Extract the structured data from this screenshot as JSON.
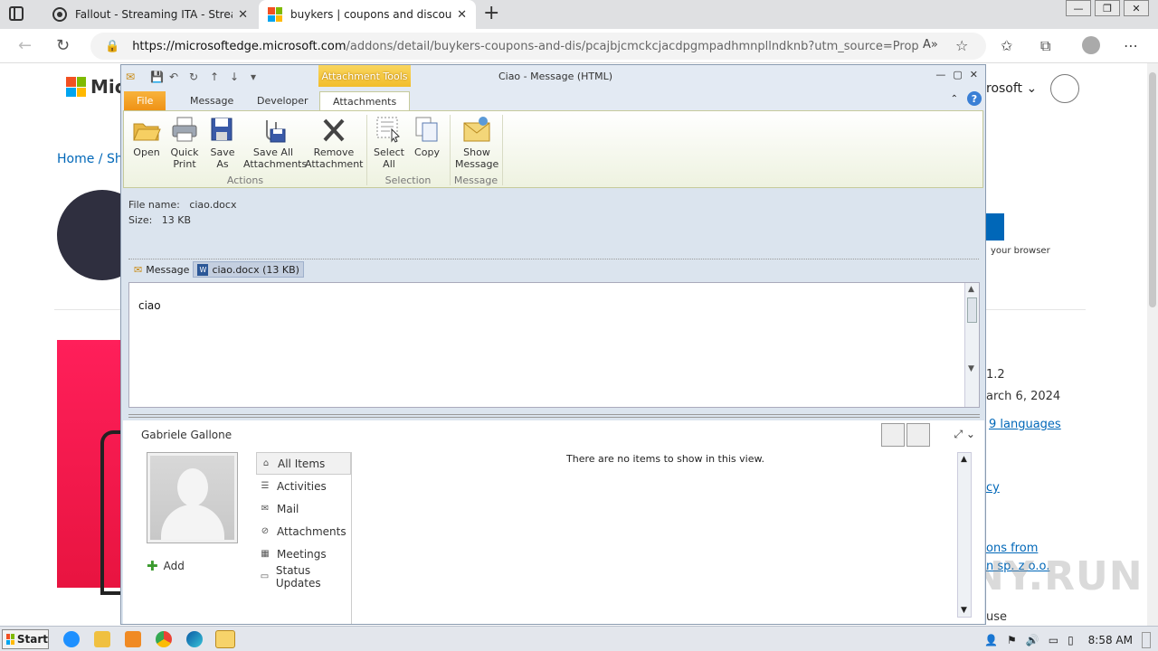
{
  "browser": {
    "tabs": [
      {
        "title": "Fallout - Streaming ITA - Streami"
      },
      {
        "title": "buykers | coupons and discount c"
      }
    ],
    "url_host": "https://microsoftedge.microsoft.com",
    "url_path": "/addons/detail/buykers-coupons-and-dis/pcajbjcmckcjacdpgmpadhmnpllndknb?utm_source=Propeller..."
  },
  "webpage": {
    "logo_text": "Mic",
    "microsoft_menu": "rosoft",
    "breadcrumb": "Home / Sho",
    "side_note": "your browser",
    "version": "1.2",
    "date": "arch 6, 2024",
    "languages": "9 languages",
    "link_cy": "cy",
    "link_ons": "ons from",
    "link_sp": "n sp. z o.o.",
    "use": "use"
  },
  "outlook": {
    "context_tab": "Attachment Tools",
    "window_title": "Ciao  -  Message (HTML)",
    "tabs": [
      "File",
      "Message",
      "Developer",
      "Attachments"
    ],
    "ribbon": {
      "actions": [
        {
          "label1": "Open",
          "label2": ""
        },
        {
          "label1": "Quick",
          "label2": "Print"
        },
        {
          "label1": "Save",
          "label2": "As"
        },
        {
          "label1": "Save All",
          "label2": "Attachments"
        },
        {
          "label1": "Remove",
          "label2": "Attachment"
        }
      ],
      "selection": [
        {
          "label1": "Select",
          "label2": "All"
        },
        {
          "label1": "Copy",
          "label2": ""
        }
      ],
      "message": [
        {
          "label1": "Show",
          "label2": "Message"
        }
      ],
      "groups": [
        "Actions",
        "Selection",
        "Message"
      ]
    },
    "file_name_label": "File name:",
    "file_name": "ciao.docx",
    "size_label": "Size:",
    "size": "13 KB",
    "attachment_bar": {
      "message": "Message",
      "file": "ciao.docx (13 KB)"
    },
    "body_text": "ciao",
    "people_pane": {
      "name": "Gabriele Gallone",
      "add": "Add",
      "items": [
        "All Items",
        "Activities",
        "Mail",
        "Attachments",
        "Meetings",
        "Status Updates"
      ],
      "empty": "There are no items to show in this view."
    }
  },
  "taskbar": {
    "start": "Start",
    "time": "8:58 AM"
  },
  "watermark": "ANY.RUN"
}
